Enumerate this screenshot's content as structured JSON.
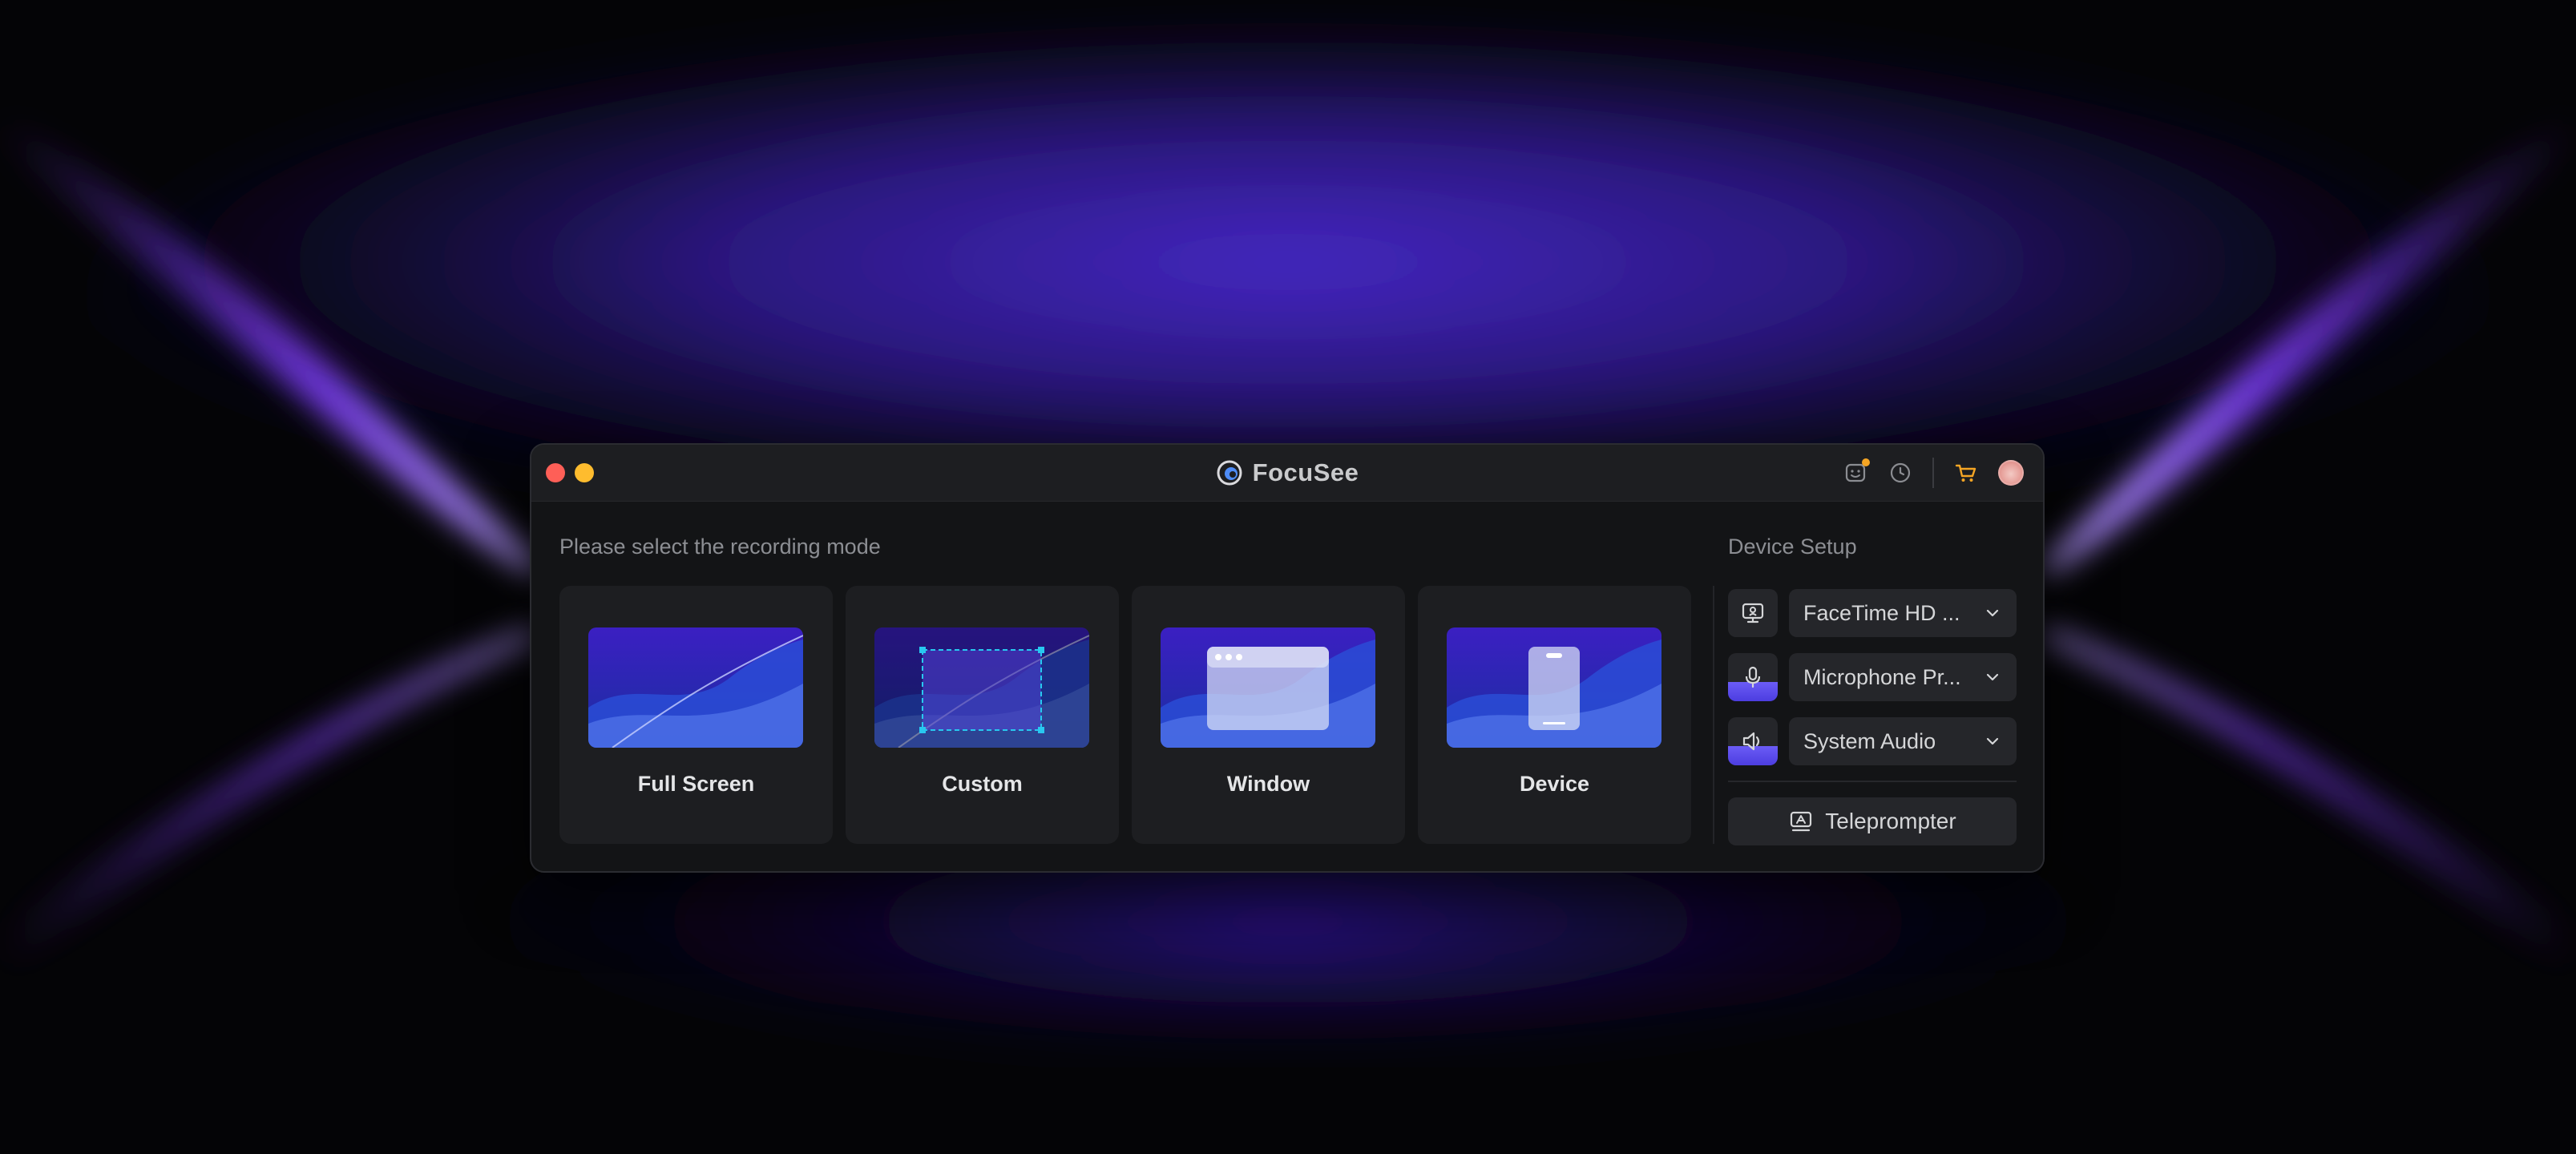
{
  "app": {
    "name": "FocuSee"
  },
  "colors": {
    "accent": "#5a4ae6",
    "selection": "#28c8f0",
    "notification": "#f5a524",
    "cart": "#f5a524"
  },
  "titlebar": {
    "icons": [
      "feedback-icon",
      "history-icon",
      "cart-icon",
      "avatar"
    ]
  },
  "recording": {
    "heading": "Please select the recording mode",
    "modes": [
      {
        "label": "Full Screen",
        "icon": "full-screen-thumbnail"
      },
      {
        "label": "Custom",
        "icon": "custom-area-thumbnail"
      },
      {
        "label": "Window",
        "icon": "window-thumbnail"
      },
      {
        "label": "Device",
        "icon": "device-thumbnail"
      }
    ]
  },
  "device_setup": {
    "heading": "Device Setup",
    "camera": {
      "value": "FaceTime HD ...",
      "icon": "camera-icon"
    },
    "microphone": {
      "value": "Microphone Pr...",
      "icon": "microphone-icon",
      "level": 0.4
    },
    "system_audio": {
      "value": "System Audio",
      "icon": "speaker-icon",
      "level": 0.4
    },
    "teleprompter": {
      "label": "Teleprompter",
      "icon": "teleprompter-icon"
    }
  }
}
